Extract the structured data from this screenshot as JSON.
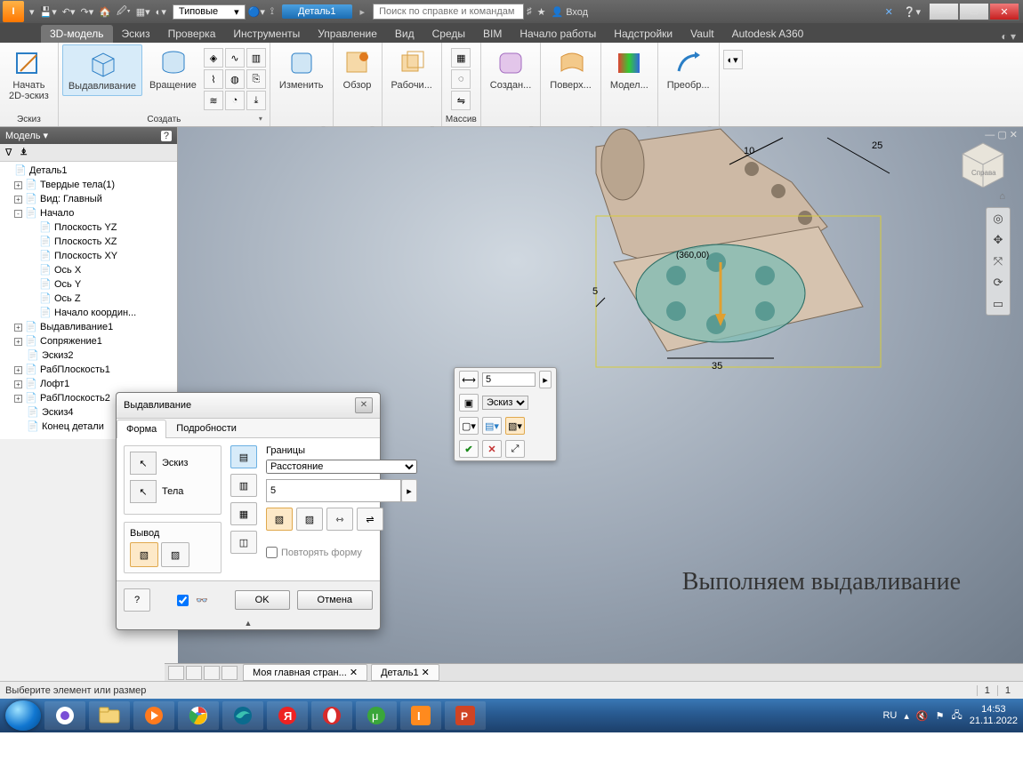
{
  "app": {
    "letter": "I",
    "style_dropdown": "Типовые",
    "doc_title": "Деталь1",
    "search_placeholder": "Поиск по справке и командам",
    "login": "Вход"
  },
  "ribbon_tabs": [
    "3D-модель",
    "Эскиз",
    "Проверка",
    "Инструменты",
    "Управление",
    "Вид",
    "Среды",
    "BIM",
    "Начало работы",
    "Надстройки",
    "Vault",
    "Autodesk A360"
  ],
  "ribbon_active": 0,
  "ribbon": {
    "panels": [
      {
        "caption": "Эскиз",
        "items": [
          {
            "label": "Начать\n2D-эскиз"
          }
        ]
      },
      {
        "caption": "Создать",
        "items": [
          {
            "label": "Выдавливание",
            "highlight": true
          },
          {
            "label": "Вращение"
          }
        ]
      },
      {
        "caption": "Изменить",
        "items": [
          {
            "label": "Изменить"
          }
        ]
      },
      {
        "caption": "Обзор",
        "items": [
          {
            "label": "Обзор"
          }
        ]
      },
      {
        "caption": "Рабочи...",
        "items": [
          {
            "label": "Рабочи..."
          }
        ]
      },
      {
        "caption": "Массив",
        "items": []
      },
      {
        "caption": "Создан...",
        "items": [
          {
            "label": "Создан..."
          }
        ]
      },
      {
        "caption": "Поверх...",
        "items": [
          {
            "label": "Поверх..."
          }
        ]
      },
      {
        "caption": "Модел...",
        "items": [
          {
            "label": "Модел..."
          }
        ]
      },
      {
        "caption": "Преобр...",
        "items": [
          {
            "label": "Преобр..."
          }
        ]
      }
    ]
  },
  "browser": {
    "title": "Модель",
    "tree": [
      {
        "lvl": 0,
        "tw": "",
        "label": "Деталь1"
      },
      {
        "lvl": 1,
        "tw": "+",
        "label": "Твердые тела(1)"
      },
      {
        "lvl": 1,
        "tw": "+",
        "label": "Вид: Главный"
      },
      {
        "lvl": 1,
        "tw": "-",
        "label": "Начало"
      },
      {
        "lvl": 2,
        "tw": "",
        "label": "Плоскость YZ"
      },
      {
        "lvl": 2,
        "tw": "",
        "label": "Плоскость XZ"
      },
      {
        "lvl": 2,
        "tw": "",
        "label": "Плоскость XY"
      },
      {
        "lvl": 2,
        "tw": "",
        "label": "Ось X"
      },
      {
        "lvl": 2,
        "tw": "",
        "label": "Ось Y"
      },
      {
        "lvl": 2,
        "tw": "",
        "label": "Ось Z"
      },
      {
        "lvl": 2,
        "tw": "",
        "label": "Начало координ..."
      },
      {
        "lvl": 1,
        "tw": "+",
        "label": "Выдавливание1"
      },
      {
        "lvl": 1,
        "tw": "+",
        "label": "Сопряжение1"
      },
      {
        "lvl": 1,
        "tw": "",
        "label": "Эскиз2"
      },
      {
        "lvl": 1,
        "tw": "+",
        "label": "РабПлоскость1"
      },
      {
        "lvl": 1,
        "tw": "+",
        "label": "Лофт1"
      },
      {
        "lvl": 1,
        "tw": "+",
        "label": "РабПлоскость2"
      },
      {
        "lvl": 1,
        "tw": "",
        "label": "Эскиз4"
      },
      {
        "lvl": 1,
        "tw": "",
        "label": "Конец детали"
      }
    ]
  },
  "dialog": {
    "title": "Выдавливание",
    "tabs": [
      "Форма",
      "Подробности"
    ],
    "sketch_label": "Эскиз",
    "body_label": "Тела",
    "output_label": "Вывод",
    "limits_label": "Границы",
    "limits_mode": "Расстояние",
    "distance": "5",
    "repeat": "Повторять форму",
    "ok": "OK",
    "cancel": "Отмена"
  },
  "mini": {
    "distance": "5",
    "profile": "Эскиз"
  },
  "canvas": {
    "caption": "Выполняем выдавливание",
    "dim1": "10",
    "dim2": "25",
    "dim3": "5",
    "dim4": "35",
    "dim5": "(360,00)"
  },
  "doctabs": {
    "home": "Моя главная стран...",
    "doc": "Деталь1"
  },
  "status": {
    "prompt": "Выберите элемент или размер",
    "n1": "1",
    "n2": "1"
  },
  "taskbar": {
    "lang": "RU",
    "time": "14:53",
    "date": "21.11.2022"
  }
}
